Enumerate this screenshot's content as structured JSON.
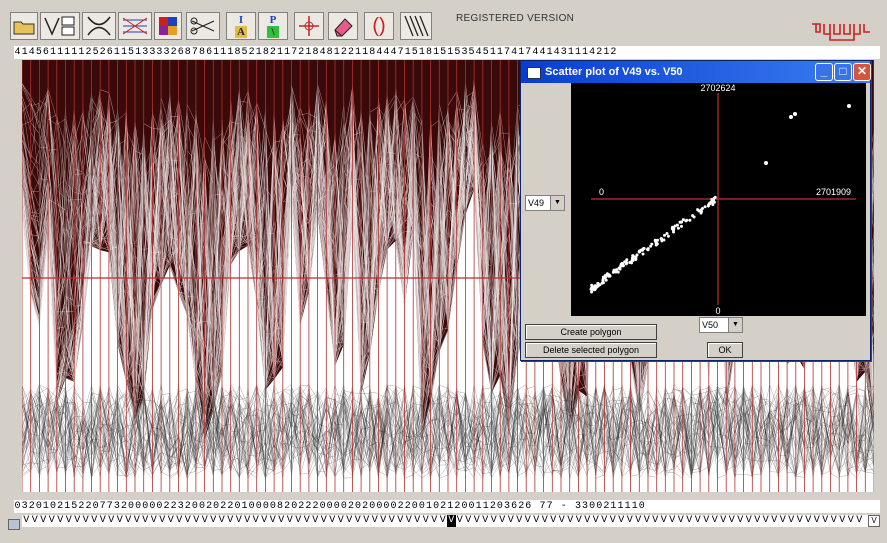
{
  "toolbar": {
    "registered_label": "REGISTERED VERSION",
    "buttons": [
      {
        "name": "open-folder",
        "icon": "folder-icon"
      },
      {
        "name": "variable-select",
        "icon": "variable-select-icon"
      },
      {
        "name": "brush",
        "icon": "brush-icon"
      },
      {
        "name": "axes",
        "icon": "axes-icon"
      },
      {
        "name": "color-grid",
        "icon": "color-grid-icon"
      },
      {
        "name": "scissors",
        "icon": "scissors-icon"
      },
      {
        "name": "i-a",
        "icon": "ia-icon",
        "top": "I",
        "bottom": "A"
      },
      {
        "name": "p-slash",
        "icon": "p-icon",
        "top": "P",
        "bottom": "\\"
      },
      {
        "name": "crosshair",
        "icon": "crosshair-icon"
      },
      {
        "name": "eraser",
        "icon": "eraser-icon"
      },
      {
        "name": "parens",
        "icon": "parens-icon",
        "label": "()"
      },
      {
        "name": "lines",
        "icon": "lines-icon"
      }
    ],
    "colors": {
      "red": "#cc2020",
      "green": "#20a020",
      "blue": "#2040c0"
    }
  },
  "top_strip": "4145611111252611513333268786111852182117218481221184447151815153545117417441431114212",
  "bottom_strip": "0320102152207732000002232002022010000820222000020200002200102120011203626 77 - 3300211110",
  "var_strip": {
    "char": "V",
    "count": 99,
    "highlighted_index": 50
  },
  "scatter_window": {
    "title": "Scatter plot of V49 vs. V50",
    "y_select": "V49",
    "x_select": "V50",
    "y_max_label": "2702624",
    "y_min_label": "0",
    "x_min_label": "0",
    "x_max_label": "2701909",
    "create_polygon_label": "Create polygon",
    "delete_polygon_label": "Delete selected polygon",
    "ok_label": "OK",
    "minimize_label": "_",
    "maximize_label": "□",
    "close_label": "✕"
  },
  "colors": {
    "axis_red": "#b03030",
    "plot_fill": "#3a0a0a",
    "title_bar": "#0a3cd0"
  }
}
